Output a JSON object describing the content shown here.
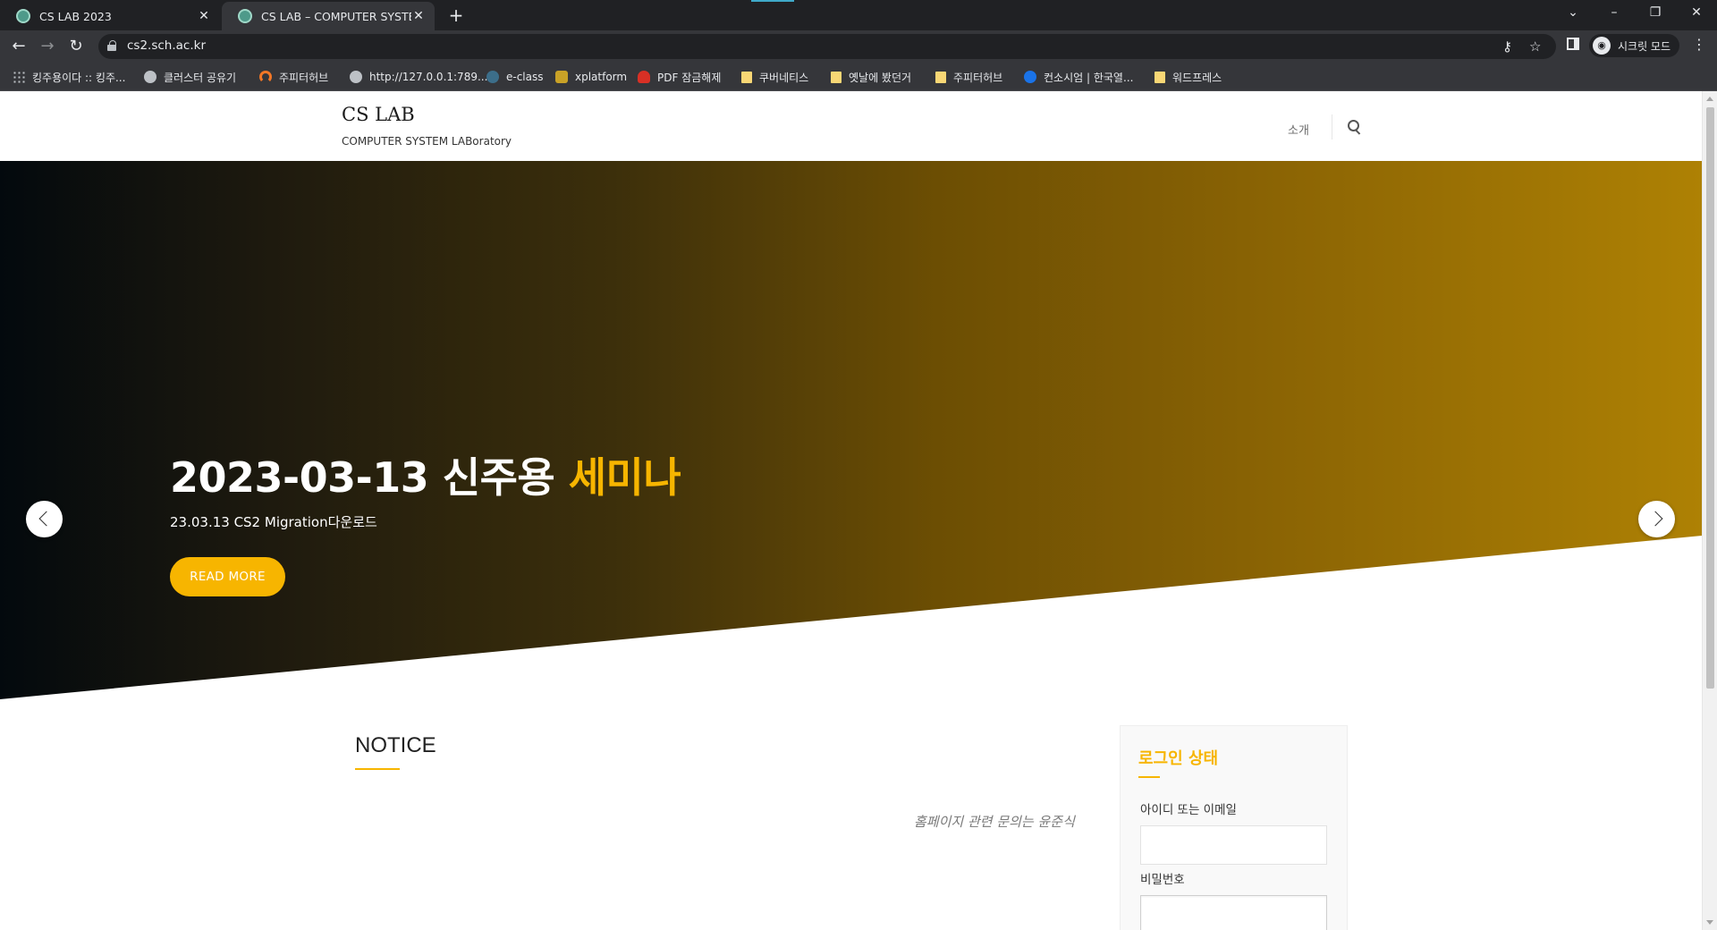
{
  "browser": {
    "tabs": [
      {
        "title": "CS LAB 2023",
        "active": false
      },
      {
        "title": "CS LAB – COMPUTER SYSTEM L",
        "active": true
      }
    ],
    "new_tab": "+",
    "address": "cs2.sch.ac.kr",
    "profile_label": "시크릿 모드",
    "bookmarks": [
      {
        "label": "킹주용이다 :: 킹주...",
        "icon": "dots-icon"
      },
      {
        "label": "클러스터 공유기",
        "icon": "globe-icon"
      },
      {
        "label": "주피터허브",
        "icon": "jupyter-icon"
      },
      {
        "label": "http://127.0.0.1:789...",
        "icon": "globe-icon"
      },
      {
        "label": "e-class",
        "icon": "eclass-icon"
      },
      {
        "label": "xplatform",
        "icon": "cat-icon"
      },
      {
        "label": "PDF 잠금해제",
        "icon": "heart-icon"
      },
      {
        "label": "쿠버네티스",
        "icon": "folder-icon"
      },
      {
        "label": "옛날에 봤던거",
        "icon": "folder-icon"
      },
      {
        "label": "주피터허브",
        "icon": "folder-icon"
      },
      {
        "label": "컨소시엄 | 한국열...",
        "icon": "consortium-icon"
      },
      {
        "label": "워드프레스",
        "icon": "folder-icon"
      }
    ]
  },
  "site": {
    "title": "CS LAB",
    "subtitle": "COMPUTER SYSTEM LABoratory",
    "nav_item": "소개",
    "accent_color": "#f7b500"
  },
  "hero": {
    "title_main": "2023-03-13 신주용 ",
    "title_highlight": "세미나",
    "subtitle": "23.03.13 CS2 Migration다운로드",
    "button": "READ MORE"
  },
  "notice": {
    "heading": "NOTICE",
    "text": "홈페이지 관련 문의는 윤준식"
  },
  "login": {
    "title": "로그인 상태",
    "username_label": "아이디 또는 이메일",
    "password_label": "비밀번호"
  }
}
